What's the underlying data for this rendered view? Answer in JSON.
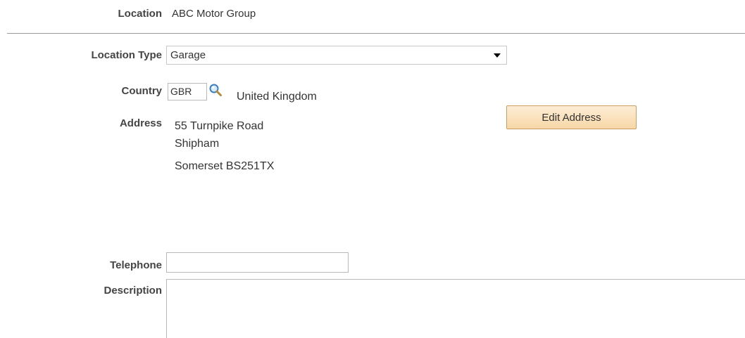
{
  "location": {
    "label": "Location",
    "value": "ABC Motor Group"
  },
  "location_type": {
    "label": "Location Type",
    "selected": "Garage"
  },
  "country": {
    "label": "Country",
    "code": "GBR",
    "name": "United Kingdom",
    "lookup_icon": "search-icon"
  },
  "address": {
    "label": "Address",
    "line1": "55 Turnpike Road",
    "line2": "Shipham",
    "line3": "Somerset BS251TX",
    "edit_label": "Edit Address"
  },
  "telephone": {
    "label": "Telephone",
    "value": ""
  },
  "description": {
    "label": "Description",
    "value": ""
  },
  "colors": {
    "button_fill": "#f7d7a6",
    "button_border": "#c99e62"
  }
}
